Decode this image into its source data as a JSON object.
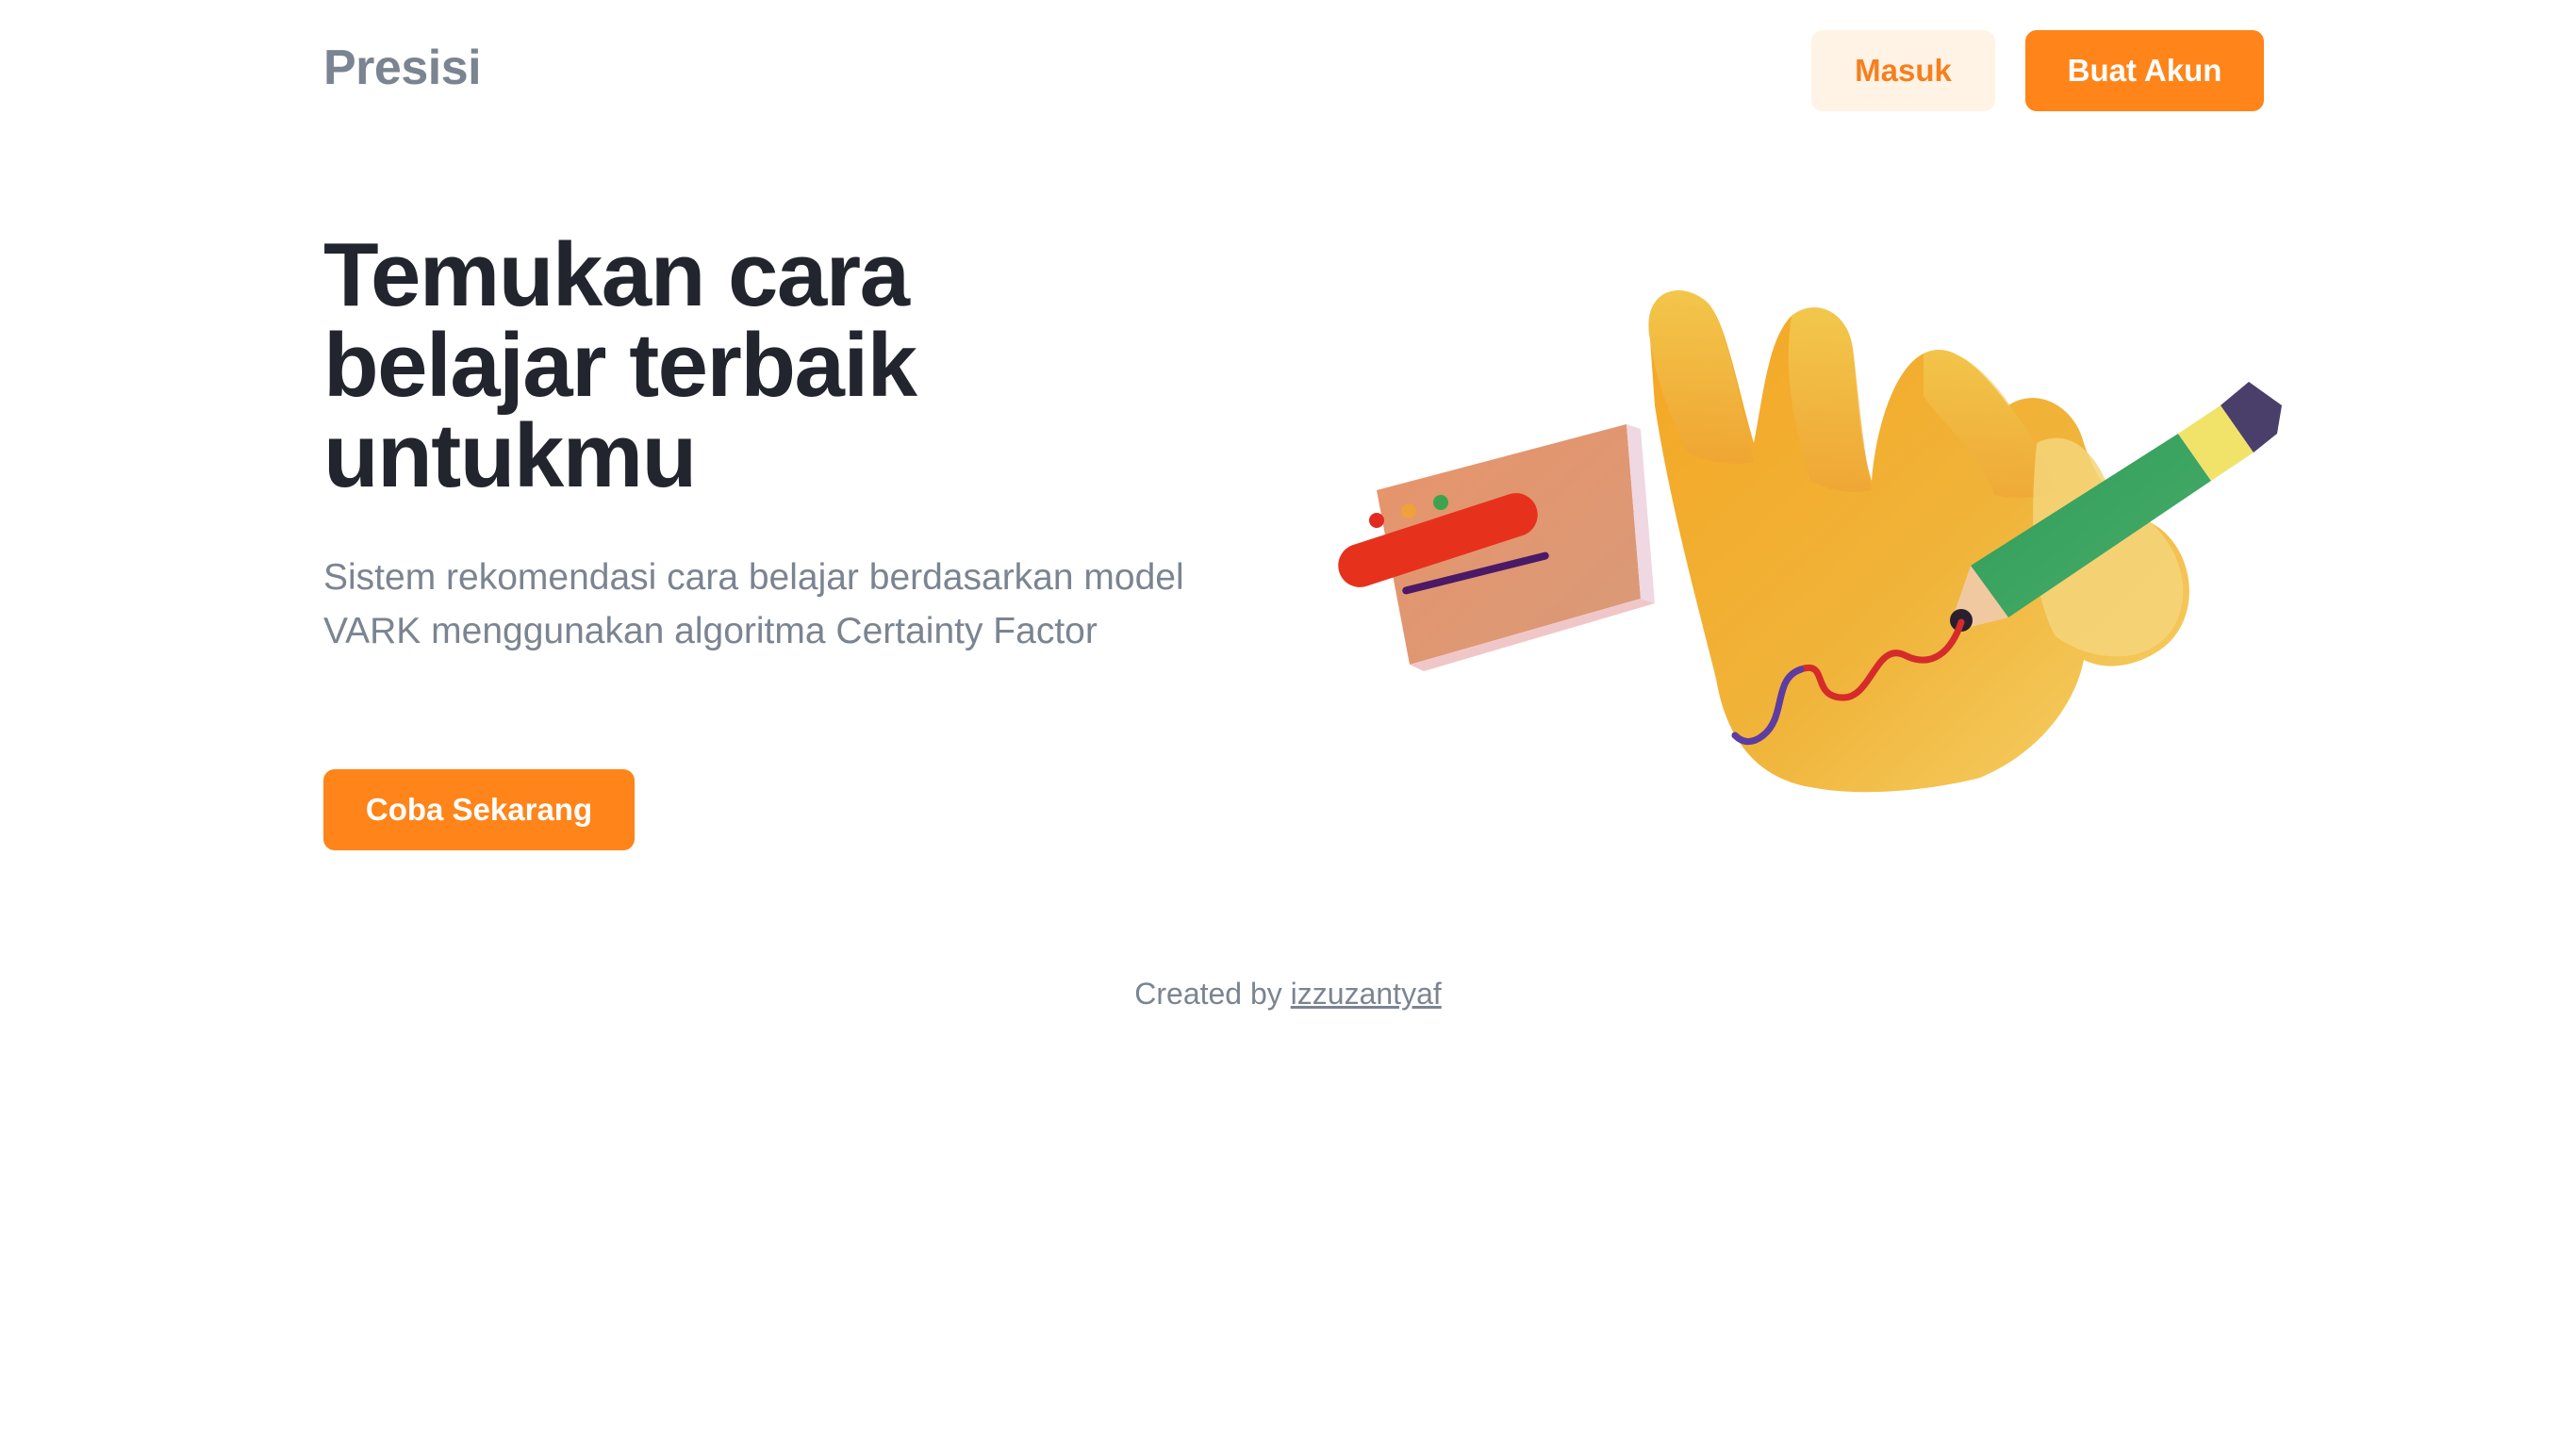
{
  "header": {
    "brand": "Presisi",
    "login_label": "Masuk",
    "register_label": "Buat Akun"
  },
  "hero": {
    "title_line1": "Temukan cara",
    "title_line2": "belajar terbaik",
    "title_line3": "untukmu",
    "subtitle": "Sistem rekomendasi cara belajar berdasarkan model VARK menggunakan algoritma Certainty Factor",
    "cta_label": "Coba Sekarang",
    "illustration": "hand-writing-with-pencil-illustration"
  },
  "footer": {
    "prefix": "Created by",
    "author_link": "izzuzantyaf"
  },
  "colors": {
    "accent": "#ff8419",
    "accent_soft": "#fff3e6",
    "heading": "#22252d",
    "muted": "#7b8491",
    "background": "#ffffff"
  }
}
